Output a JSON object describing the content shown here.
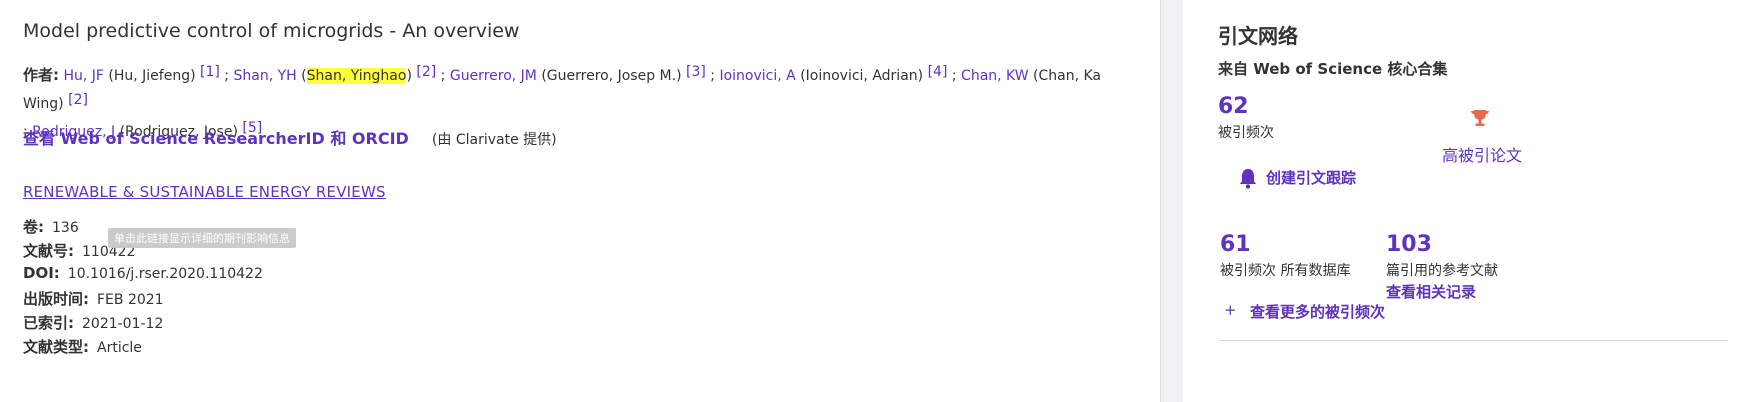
{
  "record": {
    "title": "Model predictive control of microgrids - An overview",
    "authors_label": "作者:",
    "authors": [
      {
        "short": "Hu, JF",
        "full": "(Hu, Jiefeng)",
        "ref": "[1]"
      },
      {
        "short": "Shan, YH",
        "full_pre": "(",
        "full_hl": "Shan, Yinghao",
        "full_post": ")",
        "ref": "[2]"
      },
      {
        "short": "Guerrero, JM",
        "full": "(Guerrero, Josep M.)",
        "ref": "[3]"
      },
      {
        "short": "Ioinovici, A",
        "full": "(Ioinovici, Adrian)",
        "ref": "[4]"
      },
      {
        "short": "Chan, KW",
        "full": "(Chan, Ka Wing)",
        "ref": "[2]"
      },
      {
        "short": "Rodriguez, J",
        "full": "(Rodriguez, Jose)",
        "ref": "[5]"
      }
    ],
    "researcher_link": "查看 Web of Science ResearcherID 和 ORCID",
    "provided_by": "(由 Clarivate 提供)",
    "journal": "RENEWABLE & SUSTAINABLE ENERGY REVIEWS",
    "tooltip": "单击此链接显示详细的期刊影响信息",
    "meta": [
      {
        "key": "卷:",
        "value": "136"
      },
      {
        "key": "文献号:",
        "value": "110422"
      },
      {
        "key": "DOI:",
        "value": "10.1016/j.rser.2020.110422"
      },
      {
        "key": "出版时间:",
        "value": "FEB 2021"
      },
      {
        "key": "已索引:",
        "value": "2021-01-12"
      },
      {
        "key": "文献类型:",
        "value": "Article"
      }
    ]
  },
  "sidebar": {
    "title": "引文网络",
    "subtitle": "来自 Web of Science 核心合集",
    "times_cited": "62",
    "times_cited_label": "被引频次",
    "highly_cited": "高被引论文",
    "create_alert": "创建引文跟踪",
    "all_db_count": "61",
    "all_db_label": "被引频次 所有数据库",
    "refs_count": "103",
    "refs_label": "篇引用的参考文献",
    "related": "查看相关记录",
    "more_counts": "查看更多的被引频次",
    "plus": "+"
  },
  "colors": {
    "accent": "#5e33bf",
    "highlight": "#ffff3c",
    "trophy": "#e8684a"
  }
}
